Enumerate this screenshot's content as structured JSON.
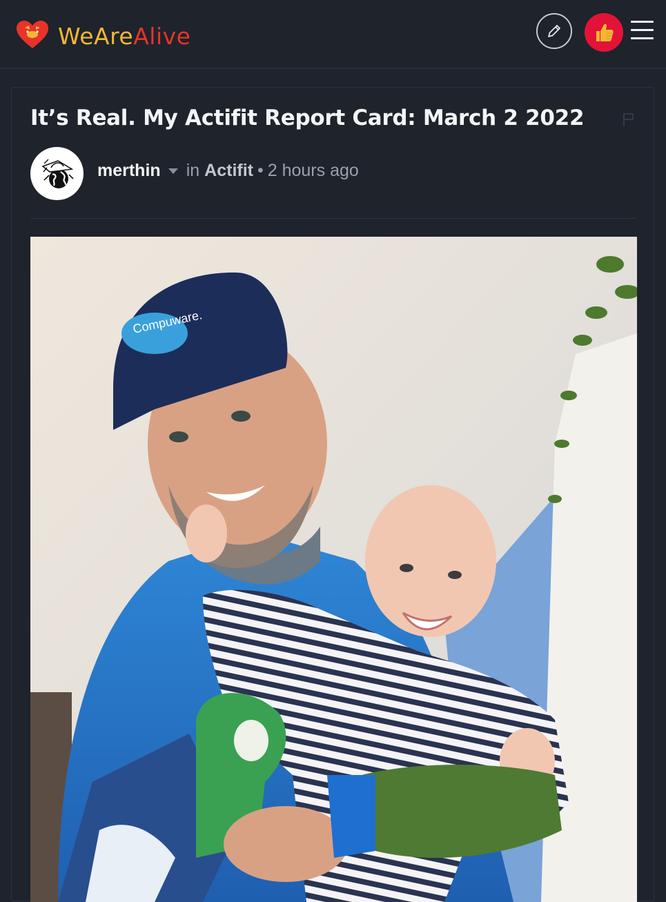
{
  "header": {
    "brand_part1": "WeAre",
    "brand_part2": "Alive",
    "edit_icon": "pencil-icon",
    "vote_icon": "thumbs-up-icon",
    "menu_icon": "hamburger-menu-icon",
    "colors": {
      "brand_yellow": "#f5b731",
      "brand_red": "#e8332b",
      "vote_bg": "#e31337",
      "background": "#1e232c"
    }
  },
  "post": {
    "title": "It’s Real. My Actifit Report Card: March 2 2022",
    "author": "merthin",
    "in_label": "in",
    "community": "Actifit",
    "separator": "•",
    "time_ago": "2 hours ago",
    "flag_icon": "flag-icon"
  }
}
